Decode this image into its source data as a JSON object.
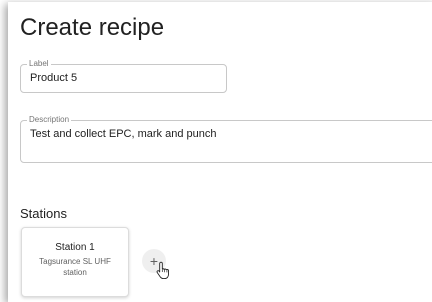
{
  "page": {
    "title": "Create recipe"
  },
  "form": {
    "label": {
      "legend": "Label",
      "value": "Product 5"
    },
    "description": {
      "legend": "Description",
      "value": "Test and collect EPC, mark and punch"
    }
  },
  "stations": {
    "heading": "Stations",
    "items": [
      {
        "name": "Station 1",
        "description": "Tagsurance SL UHF station"
      }
    ],
    "add_button_icon": "plus-icon",
    "add_button_glyph": "+"
  },
  "pointer": {
    "icon": "hand-pointer-icon"
  },
  "colors": {
    "text": "#212121",
    "border": "#c8c8c8",
    "muted": "#757575",
    "add_button_bg": "#efefef"
  }
}
